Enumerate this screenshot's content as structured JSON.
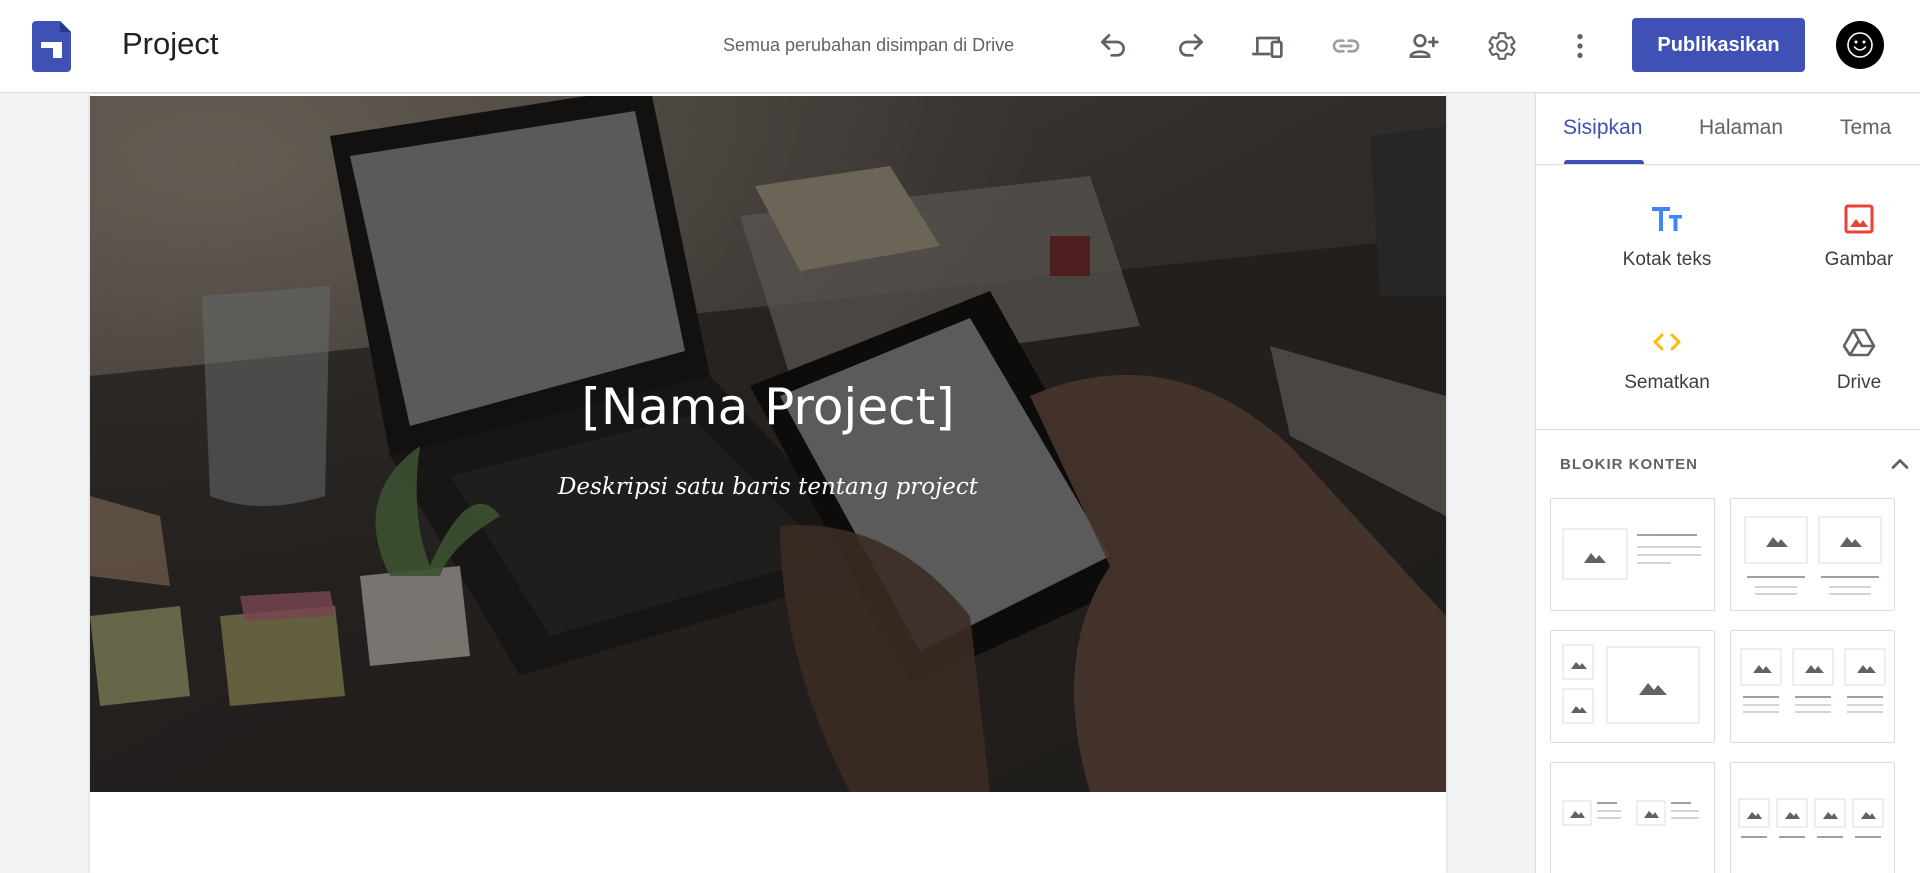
{
  "header": {
    "title": "Project",
    "save_status": "Semua perubahan disimpan di Drive",
    "publish_label": "Publikasikan"
  },
  "hero": {
    "title": "[Nama Project]",
    "subtitle": "Deskripsi satu baris tentang project"
  },
  "panel": {
    "tabs": [
      {
        "label": "Sisipkan",
        "active": true
      },
      {
        "label": "Halaman",
        "active": false
      },
      {
        "label": "Tema",
        "active": false
      }
    ],
    "insert_items": [
      {
        "label": "Kotak teks",
        "icon": "text-box-icon",
        "color": "#4285f4"
      },
      {
        "label": "Gambar",
        "icon": "image-icon",
        "color": "#ea4335"
      },
      {
        "label": "Sematkan",
        "icon": "embed-icon",
        "color": "#fbbc04"
      },
      {
        "label": "Drive",
        "icon": "drive-icon",
        "color": "#5f6368"
      }
    ],
    "content_blocks_heading": "BLOKIR KONTEN"
  },
  "colors": {
    "accent": "#3f51b5",
    "text_box": "#4285f4",
    "image": "#ea4335",
    "embed": "#fbbc04"
  }
}
